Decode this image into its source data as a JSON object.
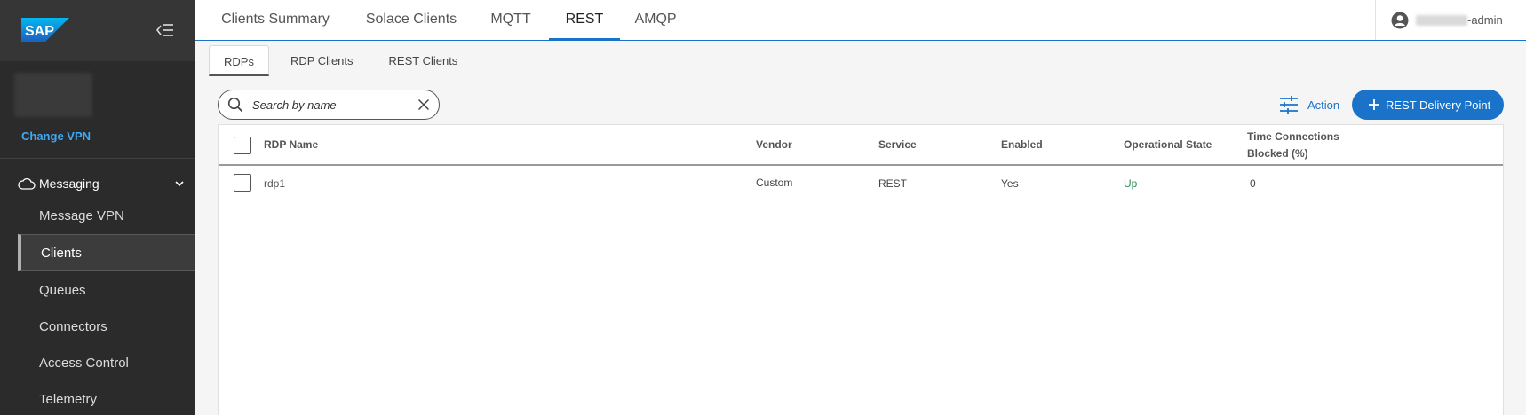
{
  "sidebar": {
    "brand": "SAP",
    "change_vpn": "Change VPN",
    "section": "Messaging",
    "items": [
      {
        "label": "Message VPN"
      },
      {
        "label": "Clients"
      },
      {
        "label": "Queues"
      },
      {
        "label": "Connectors"
      },
      {
        "label": "Access Control"
      },
      {
        "label": "Telemetry"
      }
    ]
  },
  "topbar": {
    "tabs": [
      {
        "label": "Clients Summary"
      },
      {
        "label": "Solace Clients"
      },
      {
        "label": "MQTT"
      },
      {
        "label": "REST"
      },
      {
        "label": "AMQP"
      }
    ],
    "user_suffix": "-admin"
  },
  "subtabs": [
    {
      "label": "RDPs"
    },
    {
      "label": "RDP Clients"
    },
    {
      "label": "REST Clients"
    }
  ],
  "search": {
    "placeholder": "Search by name"
  },
  "toolbar": {
    "action_label": "Action",
    "primary_label": "REST Delivery Point"
  },
  "table": {
    "headers": [
      "RDP Name",
      "Vendor",
      "Service",
      "Enabled",
      "Operational State",
      "Time Connections",
      "Blocked (%)"
    ],
    "rows": [
      {
        "name": "rdp1",
        "vendor": "Custom",
        "service": "REST",
        "enabled": "Yes",
        "state": "Up",
        "blocked": "0"
      }
    ]
  },
  "colors": {
    "accent": "#1a73c8",
    "sidebar": "#2b2b2b",
    "state_up": "#2e8b57"
  }
}
